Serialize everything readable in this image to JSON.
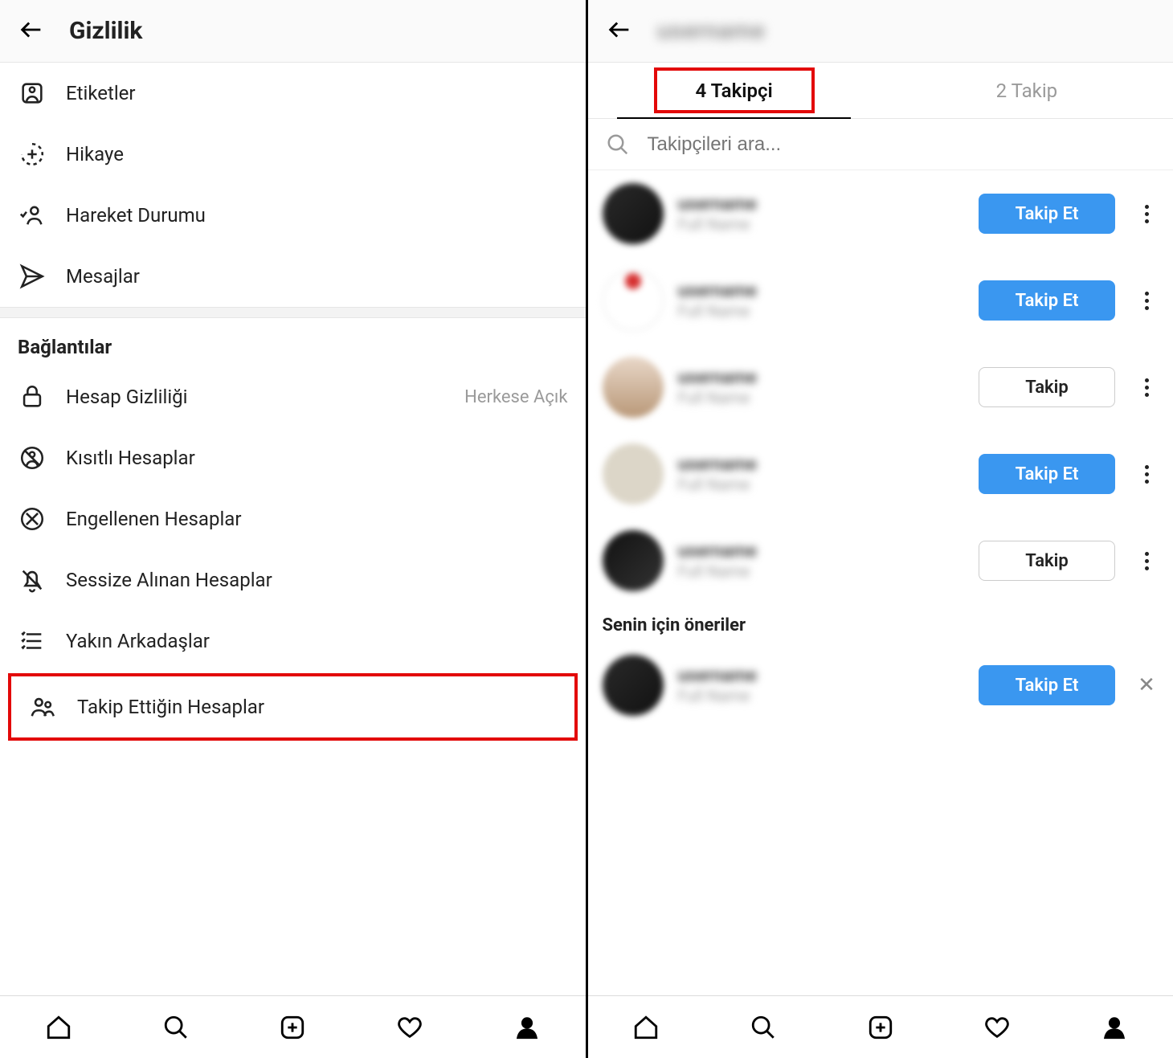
{
  "left": {
    "title": "Gizlilik",
    "items": [
      {
        "icon": "tag",
        "label": "Etiketler"
      },
      {
        "icon": "story",
        "label": "Hikaye"
      },
      {
        "icon": "activity",
        "label": "Hareket Durumu"
      },
      {
        "icon": "send",
        "label": "Mesajlar"
      }
    ],
    "section_header": "Bağlantılar",
    "items2": [
      {
        "icon": "lock",
        "label": "Hesap Gizliliği",
        "right": "Herkese Açık"
      },
      {
        "icon": "restricted",
        "label": "Kısıtlı Hesaplar"
      },
      {
        "icon": "blocked",
        "label": "Engellenen Hesaplar"
      },
      {
        "icon": "muted",
        "label": "Sessize Alınan Hesaplar"
      },
      {
        "icon": "closefriends",
        "label": "Yakın Arkadaşlar"
      },
      {
        "icon": "following",
        "label": "Takip Ettiğin Hesaplar",
        "highlighted": true
      }
    ]
  },
  "right": {
    "tab_followers": "4 Takipçi",
    "tab_following": "2 Takip",
    "search_placeholder": "Takipçileri ara...",
    "btn_follow": "Takip Et",
    "btn_following": "Takip",
    "suggestions_header": "Senin için öneriler",
    "followers": [
      {
        "avatar": "a1",
        "button": "primary",
        "menu": "dots"
      },
      {
        "avatar": "a2",
        "button": "primary",
        "menu": "dots"
      },
      {
        "avatar": "a3",
        "button": "outline",
        "menu": "dots"
      },
      {
        "avatar": "a4",
        "button": "primary",
        "menu": "dots"
      },
      {
        "avatar": "a5",
        "button": "outline",
        "menu": "dots"
      }
    ],
    "suggestions": [
      {
        "avatar": "a6",
        "button": "primary",
        "menu": "x"
      }
    ]
  }
}
